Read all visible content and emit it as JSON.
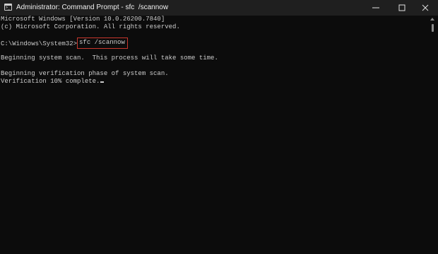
{
  "window": {
    "title": "Administrator: Command Prompt - sfc  /scannow",
    "icon": "command-prompt-icon",
    "controls": [
      "minimize-icon",
      "maximize-icon",
      "close-icon"
    ]
  },
  "console": {
    "lines": [
      "Microsoft Windows [Version 10.0.26200.7840]",
      "(c) Microsoft Corporation. All rights reserved.",
      "",
      "Beginning system scan.  This process will take some time.",
      "",
      "Beginning verification phase of system scan.",
      "Verification 10% complete."
    ],
    "prompt": "C:\\Windows\\System32>",
    "command": "sfc /scannow",
    "highlight_color": "#c8372d",
    "text_color": "#cccccc",
    "background_color": "#0c0c0c"
  }
}
